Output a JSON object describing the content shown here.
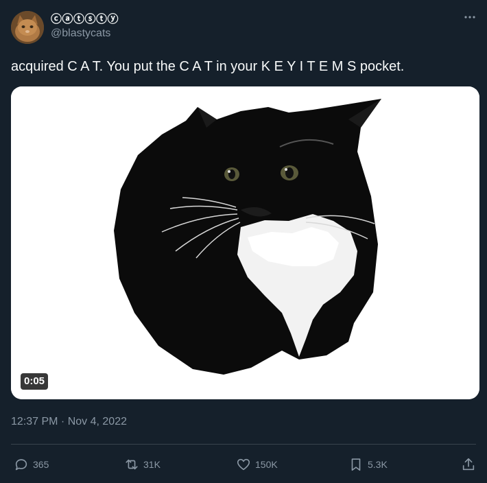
{
  "author": {
    "display_name": "ⓒⓐⓣⓢⓣⓨ",
    "handle": "@blastycats"
  },
  "tweet": {
    "text": "acquired C A T. You put the C A T in your K E Y  I T E M S pocket.",
    "timestamp": "12:37 PM · Nov 4, 2022"
  },
  "media": {
    "type": "video",
    "duration": "0:05"
  },
  "actions": {
    "replies": "365",
    "retweets": "31K",
    "likes": "150K",
    "bookmarks": "5.3K"
  },
  "colors": {
    "background": "#15202b",
    "text": "#f7f9f9",
    "muted": "#8b98a5",
    "divider": "#38444d"
  }
}
